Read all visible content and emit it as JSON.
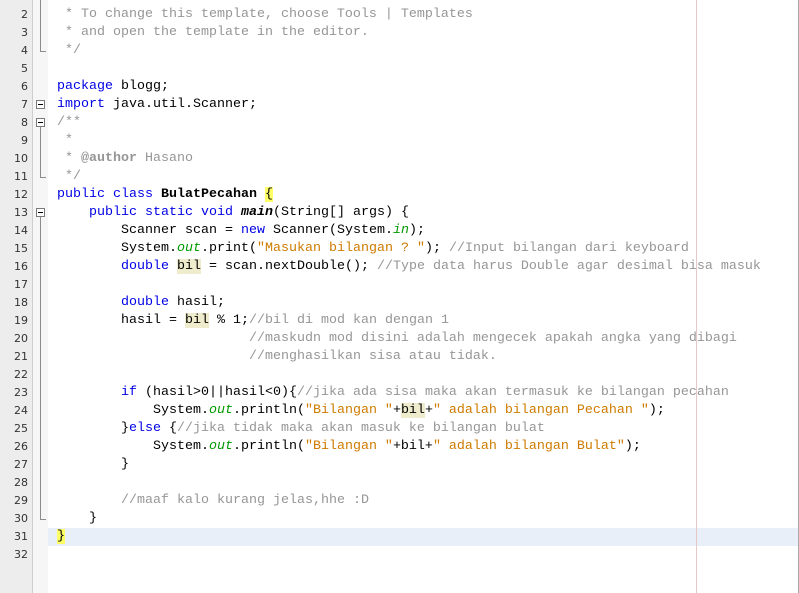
{
  "editor": {
    "theme": {
      "keyword": "#0000e6",
      "comment": "#969696",
      "string": "#ce7b00",
      "static_field": "#009900",
      "text": "#000000",
      "current_line": "#e9eff8",
      "mark_occurrence": "#eeeccc",
      "brace_match": "#ffff66",
      "margin_guide": "#e6c8c8"
    },
    "lines": [
      {
        "number": 2,
        "fold": "guide",
        "tokens": [
          {
            "type": "comment",
            "text": " * To change this template, choose Tools | Templates"
          }
        ]
      },
      {
        "number": 3,
        "fold": "guide",
        "tokens": [
          {
            "type": "comment",
            "text": " * and open the template in the editor."
          }
        ]
      },
      {
        "number": 4,
        "fold": "end",
        "tokens": [
          {
            "type": "comment",
            "text": " */"
          }
        ]
      },
      {
        "number": 5,
        "fold": "",
        "tokens": []
      },
      {
        "number": 6,
        "fold": "",
        "tokens": [
          {
            "type": "keyword",
            "text": "package"
          },
          {
            "type": "plain",
            "text": " blogg;"
          }
        ]
      },
      {
        "number": 7,
        "fold": "collapse-single",
        "tokens": [
          {
            "type": "keyword",
            "text": "import"
          },
          {
            "type": "plain",
            "text": " java.util.Scanner;"
          }
        ]
      },
      {
        "number": 8,
        "fold": "collapse",
        "tokens": [
          {
            "type": "comment",
            "text": "/**"
          }
        ]
      },
      {
        "number": 9,
        "fold": "guide",
        "tokens": [
          {
            "type": "comment",
            "text": " *"
          }
        ]
      },
      {
        "number": 10,
        "fold": "guide",
        "tokens": [
          {
            "type": "comment",
            "text": " * "
          },
          {
            "type": "javadoc-tag",
            "text": "@author"
          },
          {
            "type": "comment",
            "text": " Hasano"
          }
        ]
      },
      {
        "number": 11,
        "fold": "end",
        "tokens": [
          {
            "type": "comment",
            "text": " */"
          }
        ]
      },
      {
        "number": 12,
        "fold": "",
        "tokens": [
          {
            "type": "keyword",
            "text": "public"
          },
          {
            "type": "plain",
            "text": " "
          },
          {
            "type": "keyword",
            "text": "class"
          },
          {
            "type": "plain",
            "text": " "
          },
          {
            "type": "class-declaration",
            "text": "BulatPecahan"
          },
          {
            "type": "plain",
            "text": " "
          },
          {
            "type": "matched-brace",
            "text": "{"
          }
        ]
      },
      {
        "number": 13,
        "fold": "collapse",
        "tokens": [
          {
            "type": "plain",
            "text": "    "
          },
          {
            "type": "keyword",
            "text": "public"
          },
          {
            "type": "plain",
            "text": " "
          },
          {
            "type": "keyword",
            "text": "static"
          },
          {
            "type": "plain",
            "text": " "
          },
          {
            "type": "keyword",
            "text": "void"
          },
          {
            "type": "plain",
            "text": " "
          },
          {
            "type": "method-declaration",
            "text": "main"
          },
          {
            "type": "plain",
            "text": "(String[] args) {"
          }
        ]
      },
      {
        "number": 14,
        "fold": "guide",
        "tokens": [
          {
            "type": "plain",
            "text": "        Scanner scan = "
          },
          {
            "type": "keyword",
            "text": "new"
          },
          {
            "type": "plain",
            "text": " Scanner(System."
          },
          {
            "type": "static-field",
            "text": "in"
          },
          {
            "type": "plain",
            "text": ");"
          }
        ]
      },
      {
        "number": 15,
        "fold": "guide",
        "tokens": [
          {
            "type": "plain",
            "text": "        System."
          },
          {
            "type": "static-field",
            "text": "out"
          },
          {
            "type": "plain",
            "text": ".print("
          },
          {
            "type": "string",
            "text": "\"Masukan bilangan ? \""
          },
          {
            "type": "plain",
            "text": "); "
          },
          {
            "type": "comment",
            "text": "//Input bilangan dari keyboard"
          }
        ]
      },
      {
        "number": 16,
        "fold": "guide",
        "tokens": [
          {
            "type": "plain",
            "text": "        "
          },
          {
            "type": "keyword",
            "text": "double"
          },
          {
            "type": "plain",
            "text": " "
          },
          {
            "type": "marked-occurrence",
            "text": "bil"
          },
          {
            "type": "plain",
            "text": " = scan.nextDouble(); "
          },
          {
            "type": "comment",
            "text": "//Type data harus Double agar desimal bisa masuk"
          }
        ]
      },
      {
        "number": 17,
        "fold": "guide",
        "tokens": []
      },
      {
        "number": 18,
        "fold": "guide",
        "tokens": [
          {
            "type": "plain",
            "text": "        "
          },
          {
            "type": "keyword",
            "text": "double"
          },
          {
            "type": "plain",
            "text": " hasil;"
          }
        ]
      },
      {
        "number": 19,
        "fold": "guide",
        "tokens": [
          {
            "type": "plain",
            "text": "        hasil = "
          },
          {
            "type": "marked-occurrence",
            "text": "bil"
          },
          {
            "type": "plain",
            "text": " % 1;"
          },
          {
            "type": "comment",
            "text": "//bil di mod kan dengan 1"
          }
        ]
      },
      {
        "number": 20,
        "fold": "guide",
        "tokens": [
          {
            "type": "plain",
            "text": "                        "
          },
          {
            "type": "comment",
            "text": "//maskudn mod disini adalah mengecek apakah angka yang dibagi"
          }
        ]
      },
      {
        "number": 21,
        "fold": "guide",
        "tokens": [
          {
            "type": "plain",
            "text": "                        "
          },
          {
            "type": "comment",
            "text": "//menghasilkan sisa atau tidak."
          }
        ]
      },
      {
        "number": 22,
        "fold": "guide",
        "tokens": []
      },
      {
        "number": 23,
        "fold": "guide",
        "tokens": [
          {
            "type": "plain",
            "text": "        "
          },
          {
            "type": "keyword",
            "text": "if"
          },
          {
            "type": "plain",
            "text": " (hasil>0||hasil<0){"
          },
          {
            "type": "comment",
            "text": "//jika ada sisa maka akan termasuk ke bilangan pecahan"
          }
        ]
      },
      {
        "number": 24,
        "fold": "guide",
        "tokens": [
          {
            "type": "plain",
            "text": "            System."
          },
          {
            "type": "static-field",
            "text": "out"
          },
          {
            "type": "plain",
            "text": ".println("
          },
          {
            "type": "string",
            "text": "\"Bilangan \""
          },
          {
            "type": "plain",
            "text": "+"
          },
          {
            "type": "marked-occurrence",
            "text": "bil"
          },
          {
            "type": "plain",
            "text": "+"
          },
          {
            "type": "string",
            "text": "\" adalah bilangan Pecahan \""
          },
          {
            "type": "plain",
            "text": ");"
          }
        ]
      },
      {
        "number": 25,
        "fold": "guide",
        "tokens": [
          {
            "type": "plain",
            "text": "        }"
          },
          {
            "type": "keyword",
            "text": "else"
          },
          {
            "type": "plain",
            "text": " {"
          },
          {
            "type": "comment",
            "text": "//jika tidak maka akan masuk ke bilangan bulat"
          }
        ]
      },
      {
        "number": 26,
        "fold": "guide",
        "tokens": [
          {
            "type": "plain",
            "text": "            System."
          },
          {
            "type": "static-field",
            "text": "out"
          },
          {
            "type": "plain",
            "text": ".println("
          },
          {
            "type": "string",
            "text": "\"Bilangan \""
          },
          {
            "type": "plain",
            "text": "+bil+"
          },
          {
            "type": "string",
            "text": "\" adalah bilangan Bulat\""
          },
          {
            "type": "plain",
            "text": ");"
          }
        ]
      },
      {
        "number": 27,
        "fold": "guide",
        "tokens": [
          {
            "type": "plain",
            "text": "        }"
          }
        ]
      },
      {
        "number": 28,
        "fold": "guide",
        "tokens": []
      },
      {
        "number": 29,
        "fold": "guide",
        "tokens": [
          {
            "type": "plain",
            "text": "        "
          },
          {
            "type": "comment",
            "text": "//maaf kalo kurang jelas,hhe :D"
          }
        ]
      },
      {
        "number": 30,
        "fold": "end",
        "tokens": [
          {
            "type": "plain",
            "text": "    }"
          }
        ]
      },
      {
        "number": 31,
        "fold": "",
        "current": true,
        "tokens": [
          {
            "type": "matched-brace",
            "text": "}"
          }
        ]
      },
      {
        "number": 32,
        "fold": "",
        "tokens": []
      }
    ]
  }
}
